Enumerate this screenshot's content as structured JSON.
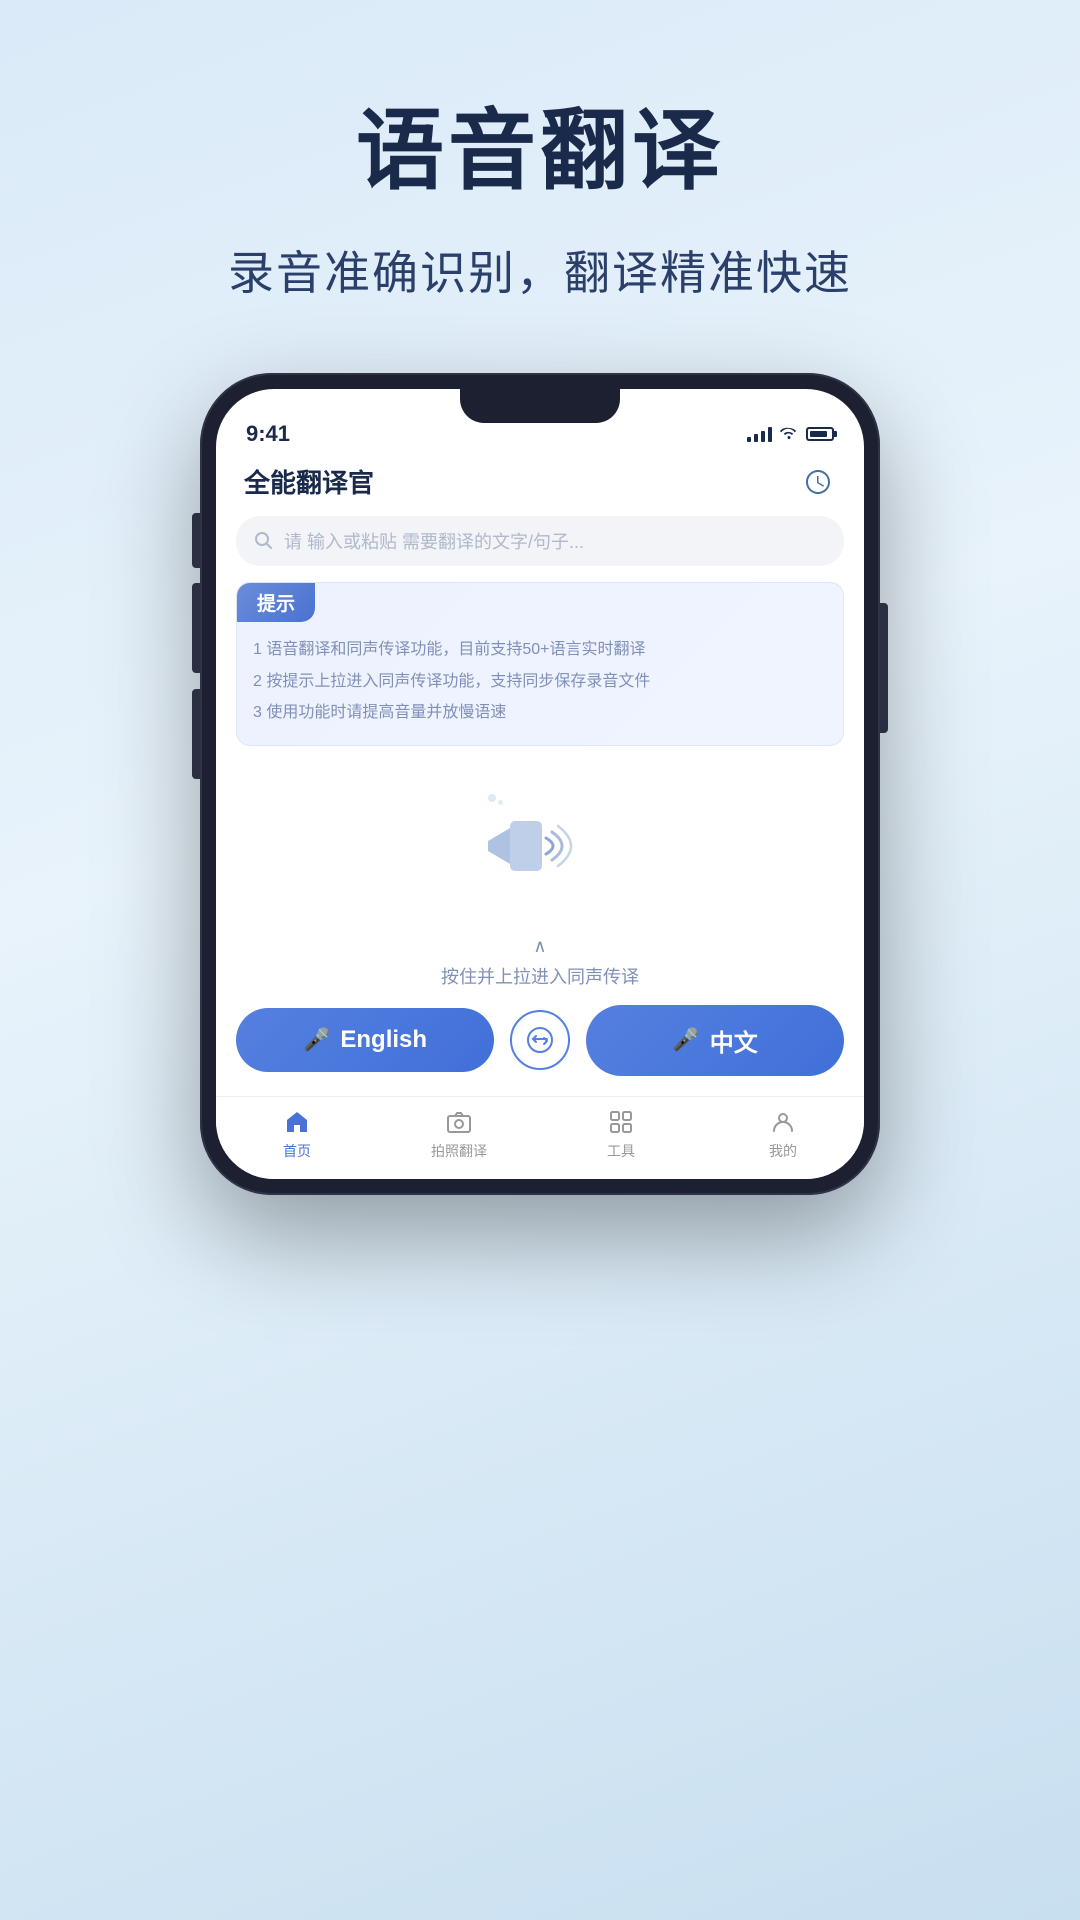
{
  "hero": {
    "title": "语音翻译",
    "subtitle": "录音准确识别，翻译精准快速"
  },
  "phone": {
    "status_time": "9:41",
    "app_title": "全能翻译官",
    "search_placeholder": "请 输入或粘贴 需要翻译的文字/句子..."
  },
  "tips": {
    "header": "提示",
    "items": [
      "1 语音翻译和同声传译功能，目前支持50+语言实时翻译",
      "2 按提示上拉进入同声传译功能，支持同步保存录音文件",
      "3 使用功能时请提高音量并放慢语速"
    ]
  },
  "slide_hint": {
    "arrow": "∧",
    "text": "按住并上拉进入同声传译"
  },
  "buttons": {
    "english_label": "English",
    "chinese_label": "中文"
  },
  "nav": {
    "items": [
      {
        "label": "首页",
        "active": true
      },
      {
        "label": "拍照翻译",
        "active": false
      },
      {
        "label": "工具",
        "active": false
      },
      {
        "label": "我的",
        "active": false
      }
    ]
  }
}
